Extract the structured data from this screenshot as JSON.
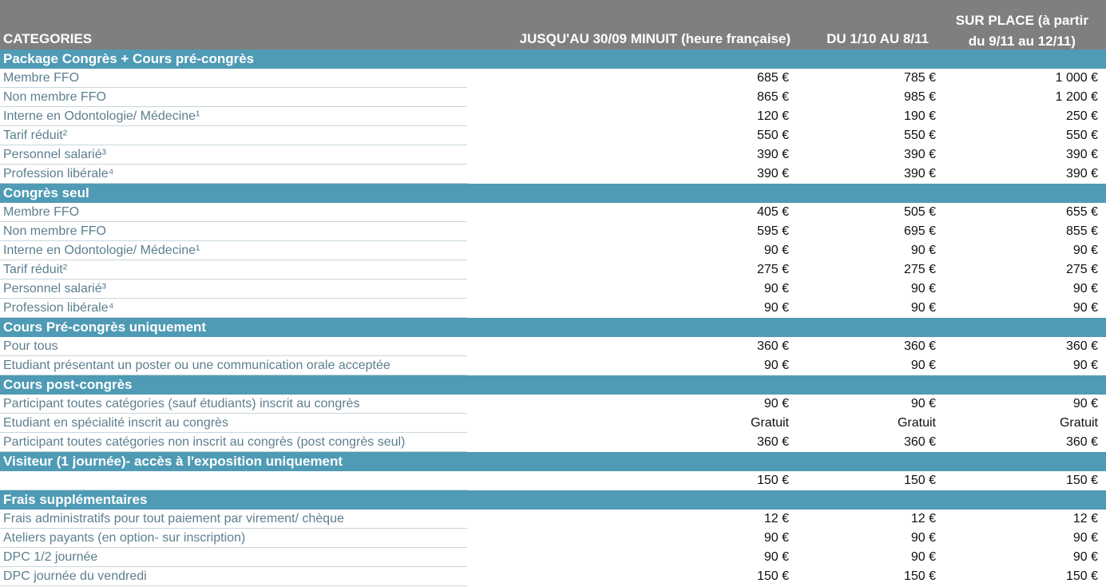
{
  "header": {
    "categories": "CATEGORIES",
    "col1": "JUSQU'AU 30/09 MINUIT (heure française)",
    "col2": "DU 1/10 AU 8/11",
    "col3_line1": "SUR PLACE (à partir",
    "col3_line2": "du 9/11 au 12/11)"
  },
  "sections": [
    {
      "title": "Package Congrès + Cours pré-congrès",
      "rows": [
        {
          "label": "Membre FFO",
          "v1": "685 €",
          "v2": "785 €",
          "v3": "1 000 €"
        },
        {
          "label": "Non membre FFO",
          "v1": "865 €",
          "v2": "985 €",
          "v3": "1 200 €"
        },
        {
          "label": "Interne en Odontologie/ Médecine¹",
          "v1": "120 €",
          "v2": "190 €",
          "v3": "250 €"
        },
        {
          "label": "Tarif réduit²",
          "v1": "550 €",
          "v2": "550 €",
          "v3": "550 €"
        },
        {
          "label": "Personnel salarié³",
          "v1": "390 €",
          "v2": "390 €",
          "v3": "390 €"
        },
        {
          "label": "Profession libérale⁴",
          "v1": "390 €",
          "v2": "390 €",
          "v3": "390 €"
        }
      ]
    },
    {
      "title": "Congrès seul",
      "rows": [
        {
          "label": "Membre FFO",
          "v1": "405 €",
          "v2": "505 €",
          "v3": "655 €"
        },
        {
          "label": "Non membre FFO",
          "v1": "595 €",
          "v2": "695 €",
          "v3": "855 €"
        },
        {
          "label": "Interne en Odontologie/ Médecine¹",
          "v1": "90 €",
          "v2": "90 €",
          "v3": "90 €"
        },
        {
          "label": "Tarif réduit²",
          "v1": "275 €",
          "v2": "275 €",
          "v3": "275 €"
        },
        {
          "label": "Personnel salarié³",
          "v1": "90 €",
          "v2": "90 €",
          "v3": "90 €"
        },
        {
          "label": "Profession libérale⁴",
          "v1": "90 €",
          "v2": "90 €",
          "v3": "90 €"
        }
      ]
    },
    {
      "title": "Cours Pré-congrès uniquement",
      "rows": [
        {
          "label": "Pour tous",
          "v1": "360 €",
          "v2": "360 €",
          "v3": "360 €"
        },
        {
          "label": "Etudiant présentant un poster ou une communication orale acceptée",
          "v1": "90 €",
          "v2": "90 €",
          "v3": "90 €"
        }
      ]
    },
    {
      "title": "Cours post-congrès",
      "rows": [
        {
          "label": "Participant toutes catégories (sauf étudiants) inscrit au congrès",
          "v1": "90 €",
          "v2": "90 €",
          "v3": "90 €"
        },
        {
          "label": "Etudiant en spécialité inscrit au congrès",
          "v1": "Gratuit",
          "v2": "Gratuit",
          "v3": "Gratuit"
        },
        {
          "label": "Participant toutes catégories non inscrit au congrès (post congrès seul)",
          "v1": "360 €",
          "v2": "360 €",
          "v3": "360 €"
        }
      ]
    },
    {
      "title": "Visiteur (1 journée)- accès à l'exposition uniquement",
      "rows": [
        {
          "label": "",
          "v1": "150 €",
          "v2": "150 €",
          "v3": "150 €"
        }
      ]
    },
    {
      "title": "Frais supplémentaires",
      "rows": [
        {
          "label": "Frais administratifs pour tout paiement par virement/ chèque",
          "v1": "12 €",
          "v2": "12 €",
          "v3": "12 €"
        },
        {
          "label": "Ateliers payants (en option- sur inscription)",
          "v1": "90 €",
          "v2": "90 €",
          "v3": "90 €"
        },
        {
          "label": "DPC 1/2 journée",
          "v1": "90 €",
          "v2": "90 €",
          "v3": "90 €"
        },
        {
          "label": "DPC journée du vendredi",
          "v1": "150 €",
          "v2": "150 €",
          "v3": "150 €"
        }
      ]
    }
  ]
}
